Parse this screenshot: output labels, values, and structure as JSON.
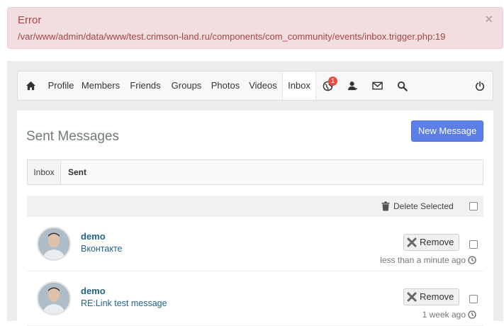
{
  "alert": {
    "title": "Error",
    "message": "/var/www/admin/data/www/test.crimson-land.ru/components/com_community/events/inbox.trigger.php:19",
    "close_glyph": "×"
  },
  "toolbar": {
    "home_icon": "home-icon",
    "items": [
      "Profile",
      "Members",
      "Friends",
      "Groups",
      "Photos",
      "Videos",
      "Inbox"
    ],
    "notification_badge": "1",
    "icons": [
      "globe-icon",
      "user-request-icon",
      "envelope-icon",
      "search-icon",
      "power-icon"
    ]
  },
  "page": {
    "title": "Sent Messages",
    "new_message_label": "New Message"
  },
  "tabs": {
    "inbox": "Inbox",
    "sent": "Sent"
  },
  "actions": {
    "delete_selected": "Delete Selected"
  },
  "messages": [
    {
      "sender": "demo",
      "subject": "Вконтакте",
      "remove_label": "Remove",
      "time": "less than a minute ago"
    },
    {
      "sender": "demo",
      "subject": "RE:Link test message",
      "remove_label": "Remove",
      "time": "1 week ago"
    }
  ],
  "colors": {
    "error_text": "#a94442",
    "primary_button": "#5b7fe6",
    "link": "#236585",
    "badge": "#e74c3c"
  }
}
